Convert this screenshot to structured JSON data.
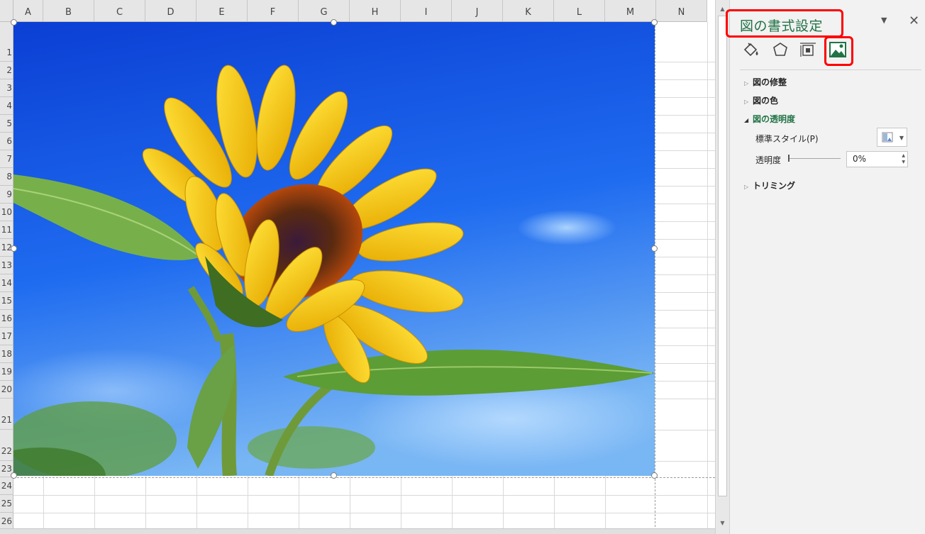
{
  "sheet": {
    "columns": [
      "A",
      "B",
      "C",
      "D",
      "E",
      "F",
      "G",
      "H",
      "I",
      "J",
      "K",
      "L",
      "M",
      "N"
    ],
    "rows": [
      "1",
      "2",
      "3",
      "4",
      "5",
      "6",
      "7",
      "8",
      "9",
      "10",
      "11",
      "12",
      "13",
      "14",
      "15",
      "16",
      "17",
      "18",
      "19",
      "20",
      "21",
      "22",
      "23",
      "24",
      "25",
      "26"
    ],
    "picture_description": "sunflower-photo"
  },
  "pane": {
    "title": "図の書式設定",
    "tabs": [
      {
        "icon": "fill-line-icon"
      },
      {
        "icon": "effects-icon"
      },
      {
        "icon": "size-properties-icon"
      },
      {
        "icon": "picture-icon"
      }
    ],
    "sections": {
      "corrections": "図の修整",
      "color": "図の色",
      "transparency": "図の透明度",
      "crop": "トリミング"
    },
    "preset_label": "標準スタイル(P)",
    "transparency_label": "透明度",
    "transparency_value": "0%"
  },
  "colors": {
    "accent": "#217346",
    "highlight": "#ff0000"
  }
}
